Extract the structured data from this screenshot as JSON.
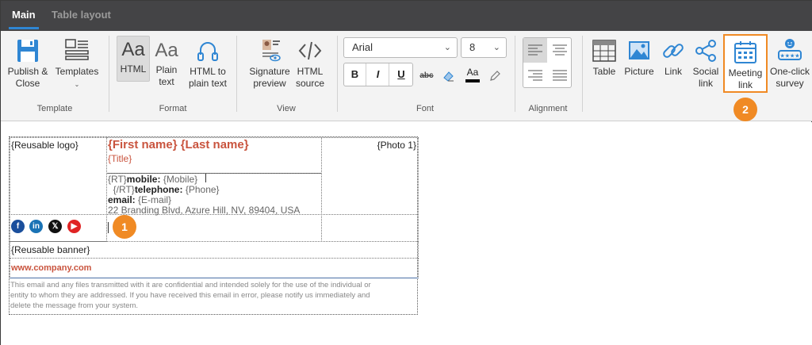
{
  "tabs": [
    {
      "label": "Main",
      "active": true
    },
    {
      "label": "Table layout",
      "active": false
    }
  ],
  "ribbon": {
    "groups": {
      "template": "Template",
      "format": "Format",
      "view": "View",
      "font": "Font",
      "alignment": "Alignment"
    },
    "buttons": {
      "publish_close": {
        "line1": "Publish &",
        "line2": "Close"
      },
      "templates": {
        "line1": "Templates"
      },
      "html": {
        "line1": "HTML",
        "icon_text": "Aa"
      },
      "plain_text": {
        "line1": "Plain",
        "line2": "text",
        "icon_text": "Aa"
      },
      "html_to_plain": {
        "line1": "HTML to",
        "line2": "plain text"
      },
      "signature_preview": {
        "line1": "Signature",
        "line2": "preview"
      },
      "html_source": {
        "line1": "HTML",
        "line2": "source"
      },
      "table": {
        "line1": "Table"
      },
      "picture": {
        "line1": "Picture"
      },
      "link": {
        "line1": "Link"
      },
      "social_link": {
        "line1": "Social",
        "line2": "link"
      },
      "meeting_link": {
        "line1": "Meeting",
        "line2": "link"
      },
      "one_click_survey": {
        "line1": "One-click",
        "line2": "survey"
      }
    },
    "font": {
      "family": "Arial",
      "size": "8",
      "bold": "B",
      "italic": "I",
      "underline": "U",
      "strikethrough": "abc",
      "font_color": "Aa"
    }
  },
  "callouts": {
    "one": "1",
    "two": "2"
  },
  "signature": {
    "logo": "{Reusable logo}",
    "name": "{First name} {Last name}",
    "title": "{Title}",
    "photo": "{Photo 1}",
    "mobile_prefix": "{RT}",
    "mobile_label": "mobile:",
    "mobile_value": "{Mobile}",
    "telephone_prefix": "{/RT}",
    "telephone_label": "telephone:",
    "telephone_value": "{Phone}",
    "email_label": "email:",
    "email_value": "{E-mail}",
    "address": "22 Branding Blvd, Azure Hill, NV, 89404, USA",
    "banner": "{Reusable banner}",
    "website": "www.company.com",
    "disclaimer_line1": "This email and any files transmitted with it are confidential and intended solely for the use of the individual or",
    "disclaimer_line2": "entity to whom they are addressed. If you have received this email in error, please notify us immediately and",
    "disclaimer_line3": "delete the message from your system.",
    "social_icons": [
      {
        "name": "facebook-icon",
        "glyph": "f",
        "color": "#1b4f9c"
      },
      {
        "name": "linkedin-icon",
        "glyph": "in",
        "color": "#1a73b5"
      },
      {
        "name": "x-icon",
        "glyph": "𝕏",
        "color": "#111111"
      },
      {
        "name": "youtube-icon",
        "glyph": "▶",
        "color": "#e02424"
      }
    ]
  },
  "colors": {
    "accent_orange": "#f08a24",
    "tab_bar": "#444446",
    "name_red": "#c9543e"
  }
}
